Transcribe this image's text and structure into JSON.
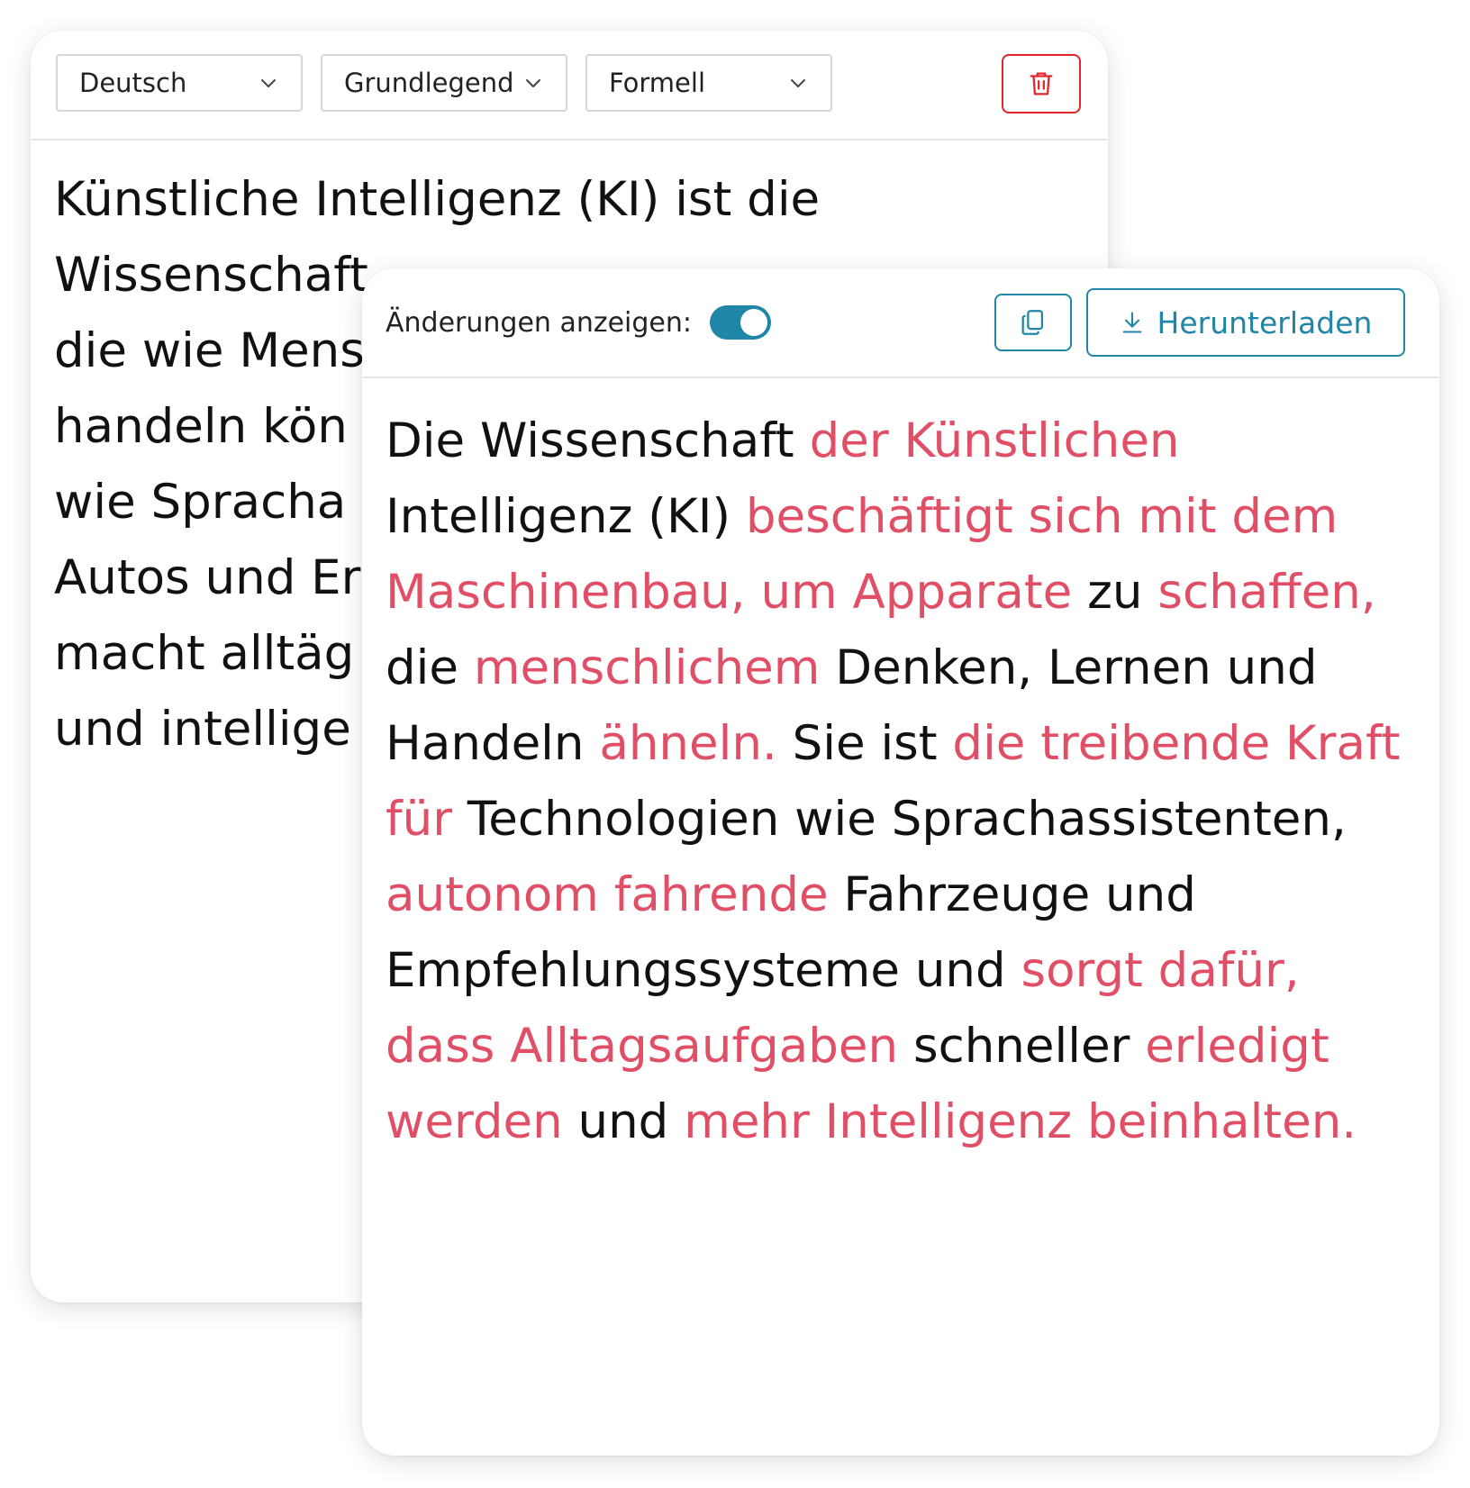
{
  "input_panel": {
    "language_select": {
      "value": "Deutsch"
    },
    "level_select": {
      "value": "Grundlegend"
    },
    "tone_select": {
      "value": "Formell"
    },
    "delete_button": {
      "icon": "trash-icon",
      "color": "#e0252c"
    },
    "text_lines": [
      "Künstliche Intelligenz (KI) ist die",
      "Wissenschaft",
      "die wie Mens",
      "handeln kön",
      "wie Spracha",
      "Autos und Er",
      "macht alltäg",
      "und intellige"
    ]
  },
  "output_panel": {
    "show_changes_label": "Änderungen anzeigen:",
    "show_changes_enabled": true,
    "copy_button": {
      "icon": "copy-icon"
    },
    "download_button": {
      "label": "Herunterladen",
      "icon": "download-icon"
    },
    "accent_color": "#1f86a8",
    "change_color": "#e14f66",
    "segments": [
      {
        "text": "Die Wissenschaft ",
        "changed": false
      },
      {
        "text": "der Künstlichen",
        "changed": true
      },
      {
        "text": " Intelligenz (KI) ",
        "changed": false
      },
      {
        "text": "beschäftigt sich mit dem Maschinenbau, um Apparate",
        "changed": true
      },
      {
        "text": " zu ",
        "changed": false
      },
      {
        "text": "schaffen,",
        "changed": true
      },
      {
        "text": " die ",
        "changed": false
      },
      {
        "text": "menschlichem",
        "changed": true
      },
      {
        "text": " Denken, Lernen und Handeln ",
        "changed": false
      },
      {
        "text": "ähneln.",
        "changed": true
      },
      {
        "text": " Sie ist ",
        "changed": false
      },
      {
        "text": "die treibende Kraft für",
        "changed": true
      },
      {
        "text": " Technologien wie Sprachassistenten, ",
        "changed": false
      },
      {
        "text": "autonom fahrende",
        "changed": true
      },
      {
        "text": " Fahrzeuge und Empfehlungssysteme und ",
        "changed": false
      },
      {
        "text": "sorgt dafür, dass Alltagsaufgaben",
        "changed": true
      },
      {
        "text": " schneller ",
        "changed": false
      },
      {
        "text": "erledigt werden",
        "changed": true
      },
      {
        "text": " und ",
        "changed": false
      },
      {
        "text": "mehr Intelligenz beinhalten.",
        "changed": true
      }
    ]
  }
}
